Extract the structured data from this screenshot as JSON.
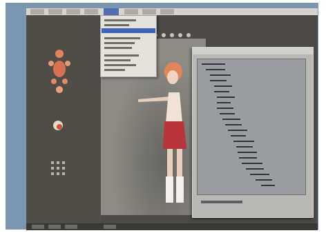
{
  "colors": {
    "bezel": "#7b96ae",
    "desktop": "#4b4a46",
    "menubar": "#d7d4cc",
    "menu_highlight": "#3d64b8",
    "viewport": "#8d8b85",
    "outliner": "#b8b8b4",
    "character_hair": "#e2865a",
    "character_outfit": "#b8343a"
  },
  "icons": {
    "figure_icon": "body-figure-icon",
    "head_icon": "head-icon",
    "grid_icon": "grid-icon"
  }
}
